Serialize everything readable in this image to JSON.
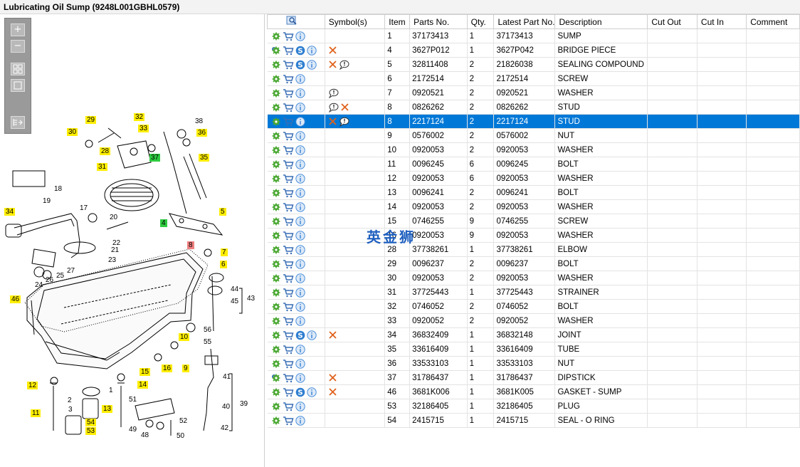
{
  "window": {
    "title": "Lubricating Oil Sump (9248L001GBHL0579)"
  },
  "toolbar": {
    "icons": [
      "zoom-in-icon",
      "zoom-out-icon",
      "fit-page-icon",
      "actual-size-icon",
      "export-icon"
    ]
  },
  "diagram": {
    "callouts": [
      {
        "label": "29",
        "style": "y"
      },
      {
        "label": "32",
        "style": "y"
      },
      {
        "label": "38",
        "style": "plain"
      },
      {
        "label": "30",
        "style": "y"
      },
      {
        "label": "33",
        "style": "y"
      },
      {
        "label": "36",
        "style": "y"
      },
      {
        "label": "28",
        "style": "y"
      },
      {
        "label": "37",
        "style": "g"
      },
      {
        "label": "35",
        "style": "y"
      },
      {
        "label": "31",
        "style": "y"
      },
      {
        "label": "18",
        "style": "plain"
      },
      {
        "label": "19",
        "style": "plain"
      },
      {
        "label": "17",
        "style": "plain"
      },
      {
        "label": "34",
        "style": "y"
      },
      {
        "label": "20",
        "style": "plain"
      },
      {
        "label": "5",
        "style": "y"
      },
      {
        "label": "4",
        "style": "g"
      },
      {
        "label": "22",
        "style": "plain"
      },
      {
        "label": "21",
        "style": "plain"
      },
      {
        "label": "8",
        "style": "r"
      },
      {
        "label": "7",
        "style": "y"
      },
      {
        "label": "23",
        "style": "plain"
      },
      {
        "label": "6",
        "style": "y"
      },
      {
        "label": "27",
        "style": "plain"
      },
      {
        "label": "26",
        "style": "plain"
      },
      {
        "label": "25",
        "style": "plain"
      },
      {
        "label": "24",
        "style": "plain"
      },
      {
        "label": "44",
        "style": "plain"
      },
      {
        "label": "46",
        "style": "y"
      },
      {
        "label": "45",
        "style": "plain"
      },
      {
        "label": "43",
        "style": "plain"
      },
      {
        "label": "56",
        "style": "plain"
      },
      {
        "label": "10",
        "style": "y"
      },
      {
        "label": "55",
        "style": "plain"
      },
      {
        "label": "16",
        "style": "y"
      },
      {
        "label": "9",
        "style": "y"
      },
      {
        "label": "15",
        "style": "y"
      },
      {
        "label": "12",
        "style": "y"
      },
      {
        "label": "14",
        "style": "y"
      },
      {
        "label": "1",
        "style": "plain"
      },
      {
        "label": "41",
        "style": "plain"
      },
      {
        "label": "2",
        "style": "plain"
      },
      {
        "label": "3",
        "style": "plain"
      },
      {
        "label": "51",
        "style": "plain"
      },
      {
        "label": "11",
        "style": "y"
      },
      {
        "label": "13",
        "style": "y"
      },
      {
        "label": "40",
        "style": "plain"
      },
      {
        "label": "39",
        "style": "plain"
      },
      {
        "label": "54",
        "style": "y"
      },
      {
        "label": "53",
        "style": "y"
      },
      {
        "label": "52",
        "style": "plain"
      },
      {
        "label": "49",
        "style": "plain"
      },
      {
        "label": "48",
        "style": "plain"
      },
      {
        "label": "50",
        "style": "plain"
      },
      {
        "label": "42",
        "style": "plain"
      }
    ]
  },
  "table": {
    "headers": {
      "icon": "search-parts-icon",
      "symbols": "Symbol(s)",
      "item": "Item",
      "parts_no": "Parts No.",
      "qty": "Qty.",
      "latest": "Latest Part No.",
      "description": "Description",
      "cut_out": "Cut Out",
      "cut_in": "Cut In",
      "comment": "Comment"
    },
    "selected_row": 6,
    "rows": [
      {
        "item": "1",
        "parts_no": "37173413",
        "qty": "1",
        "latest": "37173413",
        "description": "SUMP",
        "gear": "single",
        "s": false,
        "symbols": []
      },
      {
        "item": "4",
        "parts_no": "3627P012",
        "qty": "1",
        "latest": "3627P042",
        "description": "BRIDGE PIECE",
        "gear": "double",
        "s": true,
        "symbols": [
          "x"
        ]
      },
      {
        "item": "5",
        "parts_no": "32811408",
        "qty": "2",
        "latest": "21826038",
        "description": "SEALING COMPOUND",
        "gear": "single",
        "s": true,
        "symbols": [
          "x",
          "note"
        ]
      },
      {
        "item": "6",
        "parts_no": "2172514",
        "qty": "2",
        "latest": "2172514",
        "description": "SCREW",
        "gear": "single",
        "s": false,
        "symbols": []
      },
      {
        "item": "7",
        "parts_no": "0920521",
        "qty": "2",
        "latest": "0920521",
        "description": "WASHER",
        "gear": "single",
        "s": false,
        "symbols": [
          "note"
        ]
      },
      {
        "item": "8",
        "parts_no": "0826262",
        "qty": "2",
        "latest": "0826262",
        "description": "STUD",
        "gear": "single",
        "s": false,
        "symbols": [
          "note",
          "x"
        ]
      },
      {
        "item": "8",
        "parts_no": "2217124",
        "qty": "2",
        "latest": "2217124",
        "description": "STUD",
        "gear": "single",
        "s": false,
        "symbols": [
          "x",
          "note"
        ]
      },
      {
        "item": "9",
        "parts_no": "0576002",
        "qty": "2",
        "latest": "0576002",
        "description": "NUT",
        "gear": "single",
        "s": false,
        "symbols": []
      },
      {
        "item": "10",
        "parts_no": "0920053",
        "qty": "2",
        "latest": "0920053",
        "description": "WASHER",
        "gear": "single",
        "s": false,
        "symbols": []
      },
      {
        "item": "11",
        "parts_no": "0096245",
        "qty": "6",
        "latest": "0096245",
        "description": "BOLT",
        "gear": "single",
        "s": false,
        "symbols": []
      },
      {
        "item": "12",
        "parts_no": "0920053",
        "qty": "6",
        "latest": "0920053",
        "description": "WASHER",
        "gear": "single",
        "s": false,
        "symbols": []
      },
      {
        "item": "13",
        "parts_no": "0096241",
        "qty": "2",
        "latest": "0096241",
        "description": "BOLT",
        "gear": "single",
        "s": false,
        "symbols": []
      },
      {
        "item": "14",
        "parts_no": "0920053",
        "qty": "2",
        "latest": "0920053",
        "description": "WASHER",
        "gear": "single",
        "s": false,
        "symbols": []
      },
      {
        "item": "15",
        "parts_no": "0746255",
        "qty": "9",
        "latest": "0746255",
        "description": "SCREW",
        "gear": "single",
        "s": false,
        "symbols": []
      },
      {
        "item": "16",
        "parts_no": "0920053",
        "qty": "9",
        "latest": "0920053",
        "description": "WASHER",
        "gear": "single",
        "s": false,
        "symbols": []
      },
      {
        "item": "28",
        "parts_no": "37738261",
        "qty": "1",
        "latest": "37738261",
        "description": "ELBOW",
        "gear": "single",
        "s": false,
        "symbols": []
      },
      {
        "item": "29",
        "parts_no": "0096237",
        "qty": "2",
        "latest": "0096237",
        "description": "BOLT",
        "gear": "single",
        "s": false,
        "symbols": []
      },
      {
        "item": "30",
        "parts_no": "0920053",
        "qty": "2",
        "latest": "0920053",
        "description": "WASHER",
        "gear": "single",
        "s": false,
        "symbols": []
      },
      {
        "item": "31",
        "parts_no": "37725443",
        "qty": "1",
        "latest": "37725443",
        "description": "STRAINER",
        "gear": "single",
        "s": false,
        "symbols": []
      },
      {
        "item": "32",
        "parts_no": "0746052",
        "qty": "2",
        "latest": "0746052",
        "description": "BOLT",
        "gear": "single",
        "s": false,
        "symbols": []
      },
      {
        "item": "33",
        "parts_no": "0920052",
        "qty": "2",
        "latest": "0920052",
        "description": "WASHER",
        "gear": "single",
        "s": false,
        "symbols": []
      },
      {
        "item": "34",
        "parts_no": "36832409",
        "qty": "1",
        "latest": "36832148",
        "description": "JOINT",
        "gear": "single",
        "s": true,
        "symbols": [
          "x"
        ]
      },
      {
        "item": "35",
        "parts_no": "33616409",
        "qty": "1",
        "latest": "33616409",
        "description": "TUBE",
        "gear": "single",
        "s": false,
        "symbols": []
      },
      {
        "item": "36",
        "parts_no": "33533103",
        "qty": "1",
        "latest": "33533103",
        "description": "NUT",
        "gear": "single",
        "s": false,
        "symbols": []
      },
      {
        "item": "37",
        "parts_no": "31786437",
        "qty": "1",
        "latest": "31786437",
        "description": "DIPSTICK",
        "gear": "double",
        "s": false,
        "symbols": [
          "x"
        ]
      },
      {
        "item": "46",
        "parts_no": "3681K006",
        "qty": "1",
        "latest": "3681K005",
        "description": "GASKET - SUMP",
        "gear": "single",
        "s": true,
        "symbols": [
          "x"
        ]
      },
      {
        "item": "53",
        "parts_no": "32186405",
        "qty": "1",
        "latest": "32186405",
        "description": "PLUG",
        "gear": "single",
        "s": false,
        "symbols": []
      },
      {
        "item": "54",
        "parts_no": "2415715",
        "qty": "1",
        "latest": "2415715",
        "description": "SEAL - O RING",
        "gear": "single",
        "s": false,
        "symbols": []
      }
    ]
  },
  "watermark": "英金狮",
  "colors": {
    "selection": "#0078d7",
    "gear": "#4aa832",
    "cart": "#3a6fb5",
    "info": "#4b8fd9",
    "s_badge": "#2f7fd0",
    "x_mark": "#e0621c",
    "callout_yellow": "#ffee00",
    "callout_green": "#2ecc40",
    "callout_red": "#f08080"
  }
}
